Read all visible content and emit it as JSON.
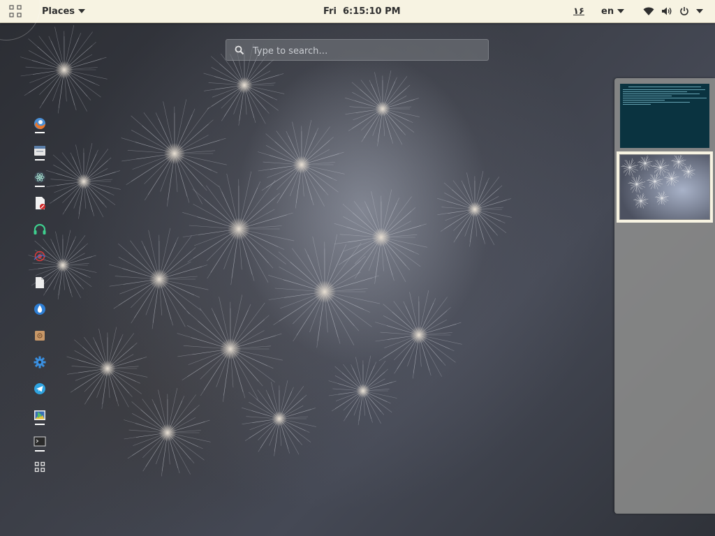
{
  "top_bar": {
    "places_label": "Places",
    "clock": "Fri  6:15:10 PM",
    "indicator_number": "۱۶",
    "language": "en"
  },
  "search": {
    "placeholder": "Type to search…"
  },
  "dash": {
    "items": [
      {
        "name": "firefox-icon",
        "running": true
      },
      {
        "name": "files-icon",
        "running": true
      },
      {
        "name": "atom-icon",
        "running": true
      },
      {
        "name": "document-viewer-icon",
        "running": false
      },
      {
        "name": "music-player-icon",
        "running": false
      },
      {
        "name": "screen-recorder-icon",
        "running": false
      },
      {
        "name": "text-editor-icon",
        "running": false
      },
      {
        "name": "drop-icon",
        "running": false
      },
      {
        "name": "archive-manager-icon",
        "running": false
      },
      {
        "name": "settings-icon",
        "running": false
      },
      {
        "name": "telegram-icon",
        "running": false
      },
      {
        "name": "image-viewer-icon",
        "running": true
      },
      {
        "name": "terminal-icon",
        "running": true
      },
      {
        "name": "show-applications-icon",
        "running": false
      }
    ]
  },
  "workspaces": {
    "count": 2,
    "active": 2
  },
  "colors": {
    "top_bar_bg": "#f7f3e2",
    "terminal_bg": "#0a3340",
    "accent": "#f7f3e2"
  }
}
